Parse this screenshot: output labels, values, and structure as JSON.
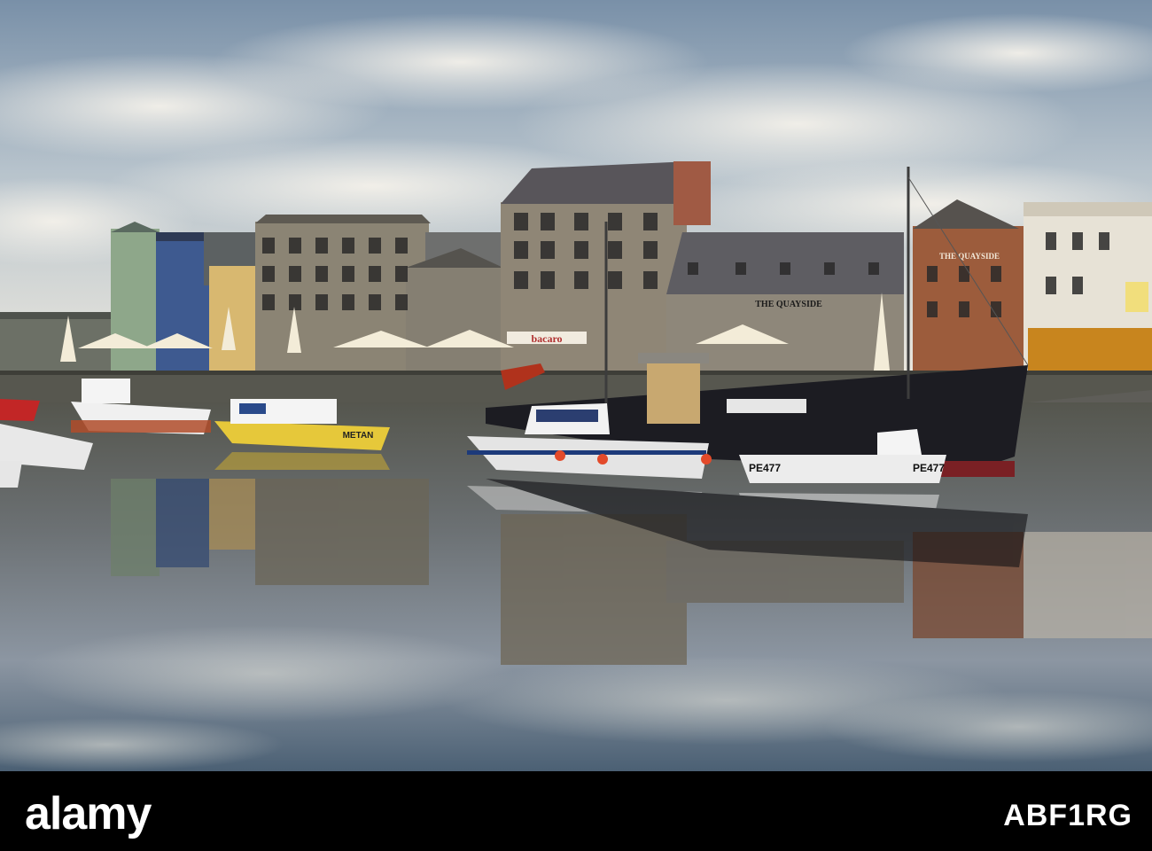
{
  "photo": {
    "subject": "harbour-quayside",
    "signs": {
      "bar_awning": "bacaro",
      "pub_facade": "THE QUAYSIDE",
      "pub_gable": "THE QUAYSIDE",
      "yellow_boat": "METAN",
      "dinghy_bow": "PE477",
      "dinghy_stern": "PE477"
    }
  },
  "watermark": {
    "logo": "alamy",
    "image_id": "ABF1RG"
  },
  "colors": {
    "sky_top": "#7e95ab",
    "sky_bottom": "#eeeae2",
    "water_top": "#5a5a52",
    "water_bottom": "#4a5f72",
    "stone": "#8a8272",
    "pub_brick": "#9a5a3a",
    "ship_hull": "#1c1c22",
    "footer": "#000000"
  }
}
